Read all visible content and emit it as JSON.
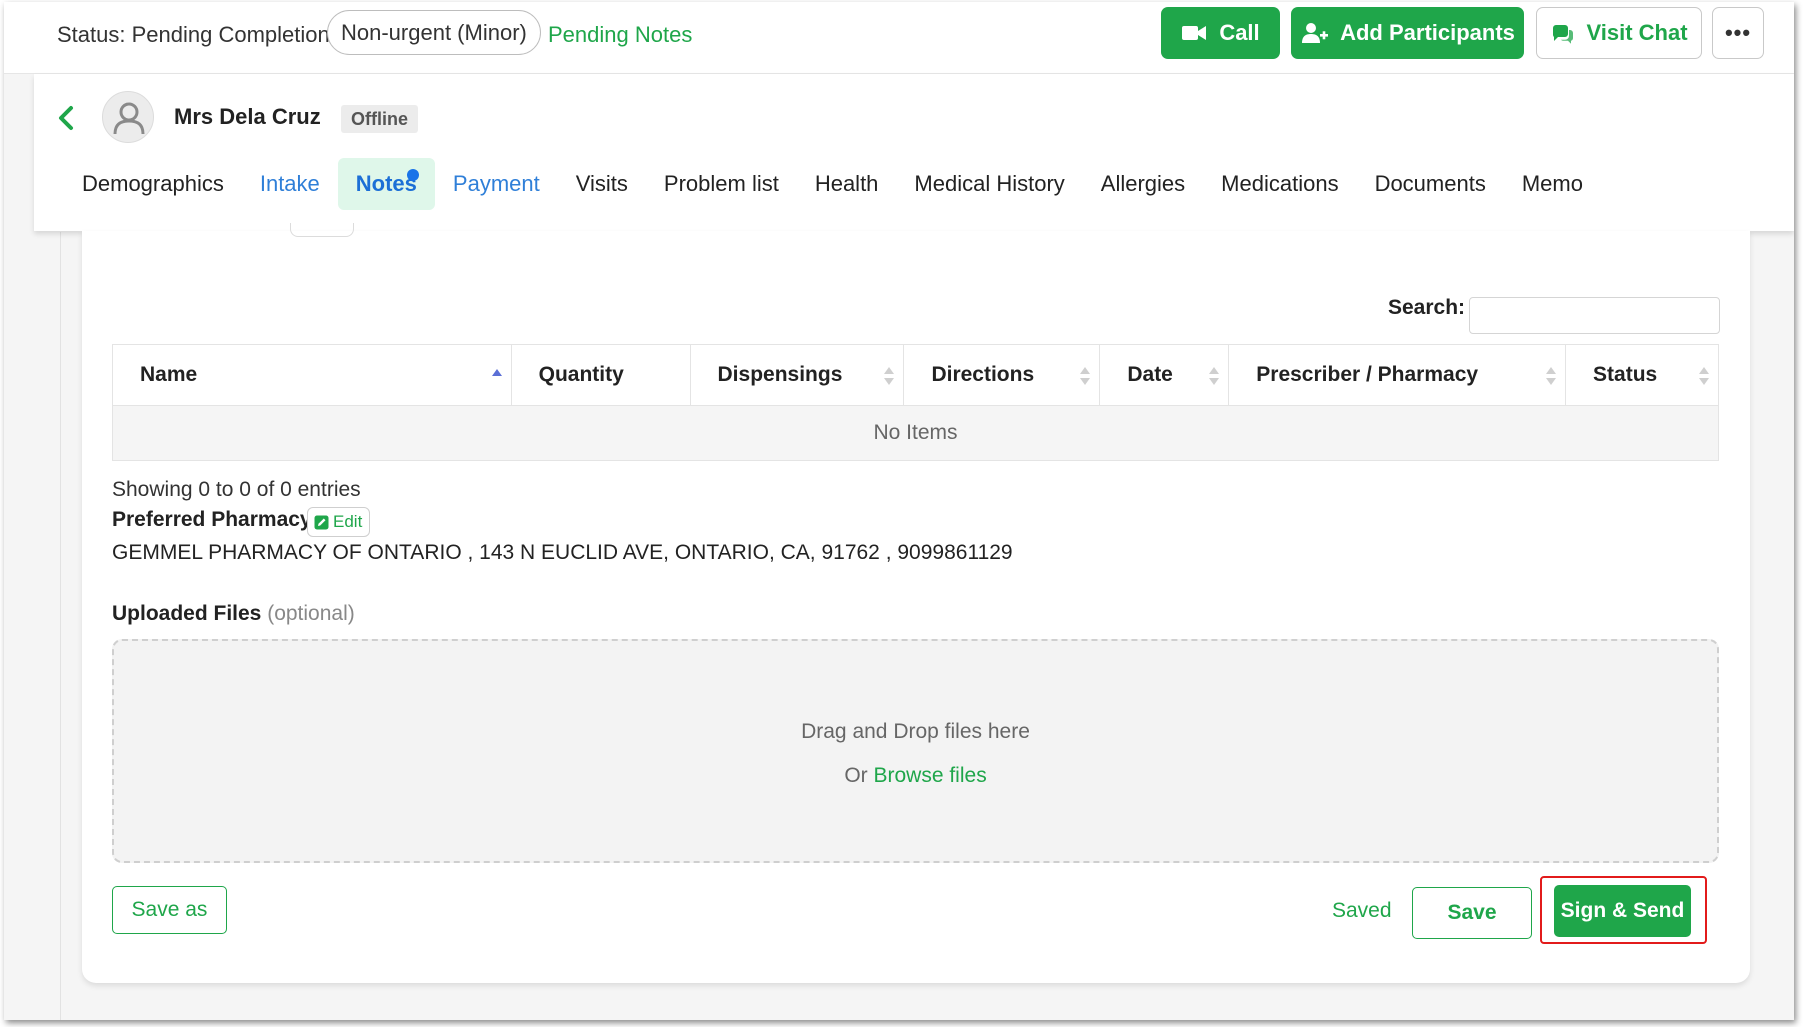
{
  "topbar": {
    "status_text": "Status: Pending Completion",
    "urgency": "Non-urgent (Minor)",
    "pending_notes": "Pending Notes",
    "call_label": "Call",
    "add_participants_label": "Add Participants",
    "visit_chat_label": "Visit Chat",
    "more_label": "•••"
  },
  "patient": {
    "name": "Mrs Dela Cruz",
    "status": "Offline"
  },
  "tabs": [
    {
      "label": "Demographics"
    },
    {
      "label": "Intake"
    },
    {
      "label": "Notes"
    },
    {
      "label": "Payment"
    },
    {
      "label": "Visits"
    },
    {
      "label": "Problem list"
    },
    {
      "label": "Health"
    },
    {
      "label": "Medical History"
    },
    {
      "label": "Allergies"
    },
    {
      "label": "Medications"
    },
    {
      "label": "Documents"
    },
    {
      "label": "Memo"
    }
  ],
  "table": {
    "search_label": "Search:",
    "search_value": "",
    "columns": [
      "Name",
      "Quantity",
      "Dispensings",
      "Directions",
      "Date",
      "Prescriber / Pharmacy",
      "Status"
    ],
    "empty_text": "No Items",
    "entries_text": "Showing 0 to 0 of 0 entries"
  },
  "pharmacy": {
    "label": "Preferred Pharmacy",
    "edit_label": "Edit",
    "value": "GEMMEL PHARMACY OF ONTARIO , 143 N EUCLID AVE, ONTARIO, CA, 91762 , 9099861129"
  },
  "uploads": {
    "label": "Uploaded Files",
    "optional": "(optional)",
    "drop_text": "Drag and Drop files here",
    "or_text": "Or ",
    "browse_text": "Browse files"
  },
  "actions": {
    "save_as": "Save as",
    "saved": "Saved",
    "save": "Save",
    "sign_send": "Sign & Send"
  },
  "colors": {
    "brand_green": "#1fa64a",
    "tab_link_blue": "#2f7fd8",
    "active_tab_bg": "#dff7ea",
    "notification_dot": "#1a73e8",
    "highlight_red": "#e21b1b"
  }
}
